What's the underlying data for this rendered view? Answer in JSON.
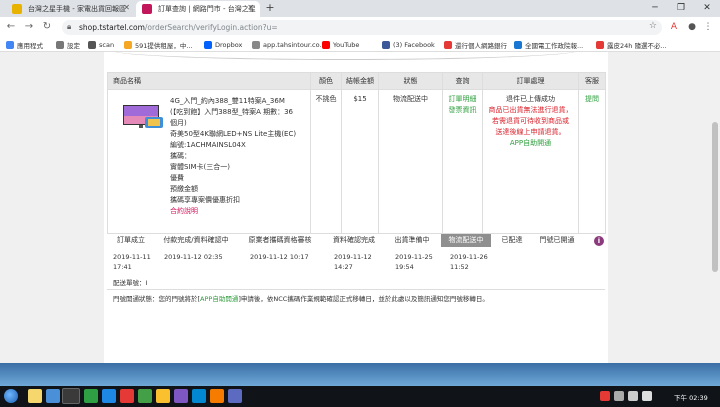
{
  "browser": {
    "tabs": [
      {
        "title": "台灣之星手機 - 家電出貨回報區",
        "favicon_color": "#e8b200"
      },
      {
        "title": "訂單查詢 | 網路門市 - 台灣之星",
        "favicon_color": "#c2185b"
      }
    ],
    "new_tab_label": "+",
    "url_host": "shop.tstartel.com",
    "url_path": "/orderSearch/verifyLogin.action?u=",
    "bookmarks": [
      {
        "label": "應用程式",
        "color": "#4285f4"
      },
      {
        "label": "設定",
        "color": "#777"
      },
      {
        "label": "scan",
        "color": "#555"
      },
      {
        "label": "591提供租屋，中...",
        "color": "#f5a623"
      },
      {
        "label": "Dropbox",
        "color": "#0061fe"
      },
      {
        "label": "app.tahsintour.co...",
        "color": "#888"
      },
      {
        "label": "YouTube",
        "color": "#ff0000"
      },
      {
        "label": "(3) Facebook",
        "color": "#3b5998"
      },
      {
        "label": "還行個人網路銀行",
        "color": "#e53935"
      },
      {
        "label": "全國電工作政院報...",
        "color": "#1976d2"
      },
      {
        "label": "露皮24h 隨選不必...",
        "color": "#e53935"
      }
    ]
  },
  "order": {
    "headers": {
      "product": "商品名稱",
      "color": "顏色",
      "amount": "結帳金額",
      "status": "狀態",
      "query": "查詢",
      "handling": "訂單處理",
      "service": "客服"
    },
    "product_lines": [
      "4G_入門_約內388_雙11特案A_36M",
      "(【吃到飽】入門388型_特案A 期數：36",
      "個月)",
      "奇美50型4K聯網LED+NS Lite主機(EC)",
      "編號:1ACHMAINSL04X",
      "攜碼：",
      "實體SIM卡(三合一)",
      "優費",
      "預繳金額",
      "攜碼享專案價優惠折扣"
    ],
    "product_link": "合約說明",
    "color_value": "不挑色",
    "amount_value": "$15",
    "status_value": "物流配送中",
    "query_links": [
      "訂單明細",
      "發票資訊"
    ],
    "handling_lines": [
      "退件已上傳成功",
      "商品已出貨無法進行退貨，",
      "若需退貨可待收到商品或",
      "送達後線上申請退貨。"
    ],
    "handling_link": "APP自助開通",
    "service_link": "提問"
  },
  "progress": {
    "steps": [
      "訂單成立",
      "付款完成/資料確認中",
      "原業者攜碼資格審核",
      "資料確認完成",
      "出貨準備中",
      "物流配送中",
      "已配達",
      "門號已開通"
    ],
    "active_index": 5,
    "times": [
      "2019-11-11\n17:41",
      "2019-11-12 02:35",
      "2019-11-12 10:17",
      "2019-11-12\n14:27",
      "2019-11-25\n19:54",
      "2019-11-26\n11:52"
    ]
  },
  "delivery_label": "配送單號：I",
  "note": {
    "prefix": "門號開通狀態：您的門號將於",
    "link": "APP自助開通",
    "suffix": "申請後，依NCC攜碼作業規範確認正式移轉日，並於此處以及簡訊通知您門號移轉日。"
  },
  "taskbar": {
    "clock": "下午 02:39"
  }
}
